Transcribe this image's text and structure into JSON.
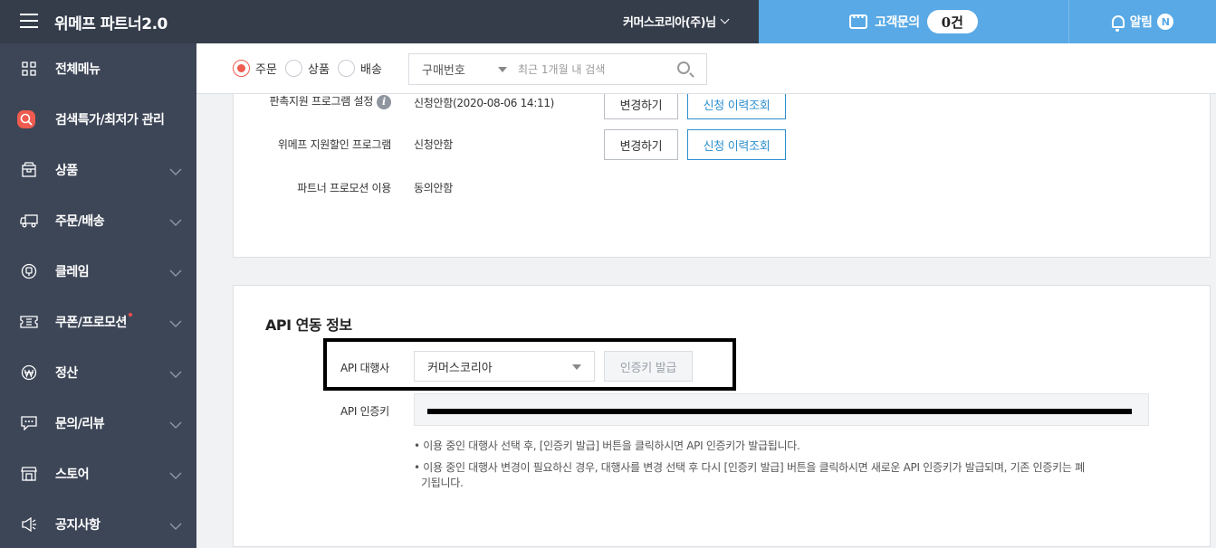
{
  "header": {
    "brand": "위메프 파트너2.0",
    "account": "커머스코리아(주)님",
    "cs_label": "고객문의",
    "cs_count": "0건",
    "alarm_label": "알림",
    "alarm_badge": "N"
  },
  "sidebar": {
    "items": [
      {
        "label": "전체메뉴",
        "icon": "grid-icon"
      },
      {
        "label": "검색특가/최저가 관리",
        "icon": "search-icon"
      },
      {
        "label": "상품",
        "icon": "box-icon"
      },
      {
        "label": "주문/배송",
        "icon": "truck-icon"
      },
      {
        "label": "클레임",
        "icon": "claim-icon"
      },
      {
        "label": "쿠폰/프로모션",
        "icon": "ticket-icon"
      },
      {
        "label": "정산",
        "icon": "won-icon"
      },
      {
        "label": "문의/리뷰",
        "icon": "chat-icon"
      },
      {
        "label": "스토어",
        "icon": "store-icon"
      },
      {
        "label": "공지사항",
        "icon": "megaphone-icon"
      }
    ]
  },
  "filterbar": {
    "radios": [
      "주문",
      "상품",
      "배송"
    ],
    "selected": "주문",
    "search_type": "구매번호",
    "search_placeholder": "최근 1개월 내 검색"
  },
  "promo": {
    "rows": [
      {
        "label": "판촉지원 프로그램 설정",
        "value": "신청안함(2020-08-06 14:11)"
      },
      {
        "label": "위메프 지원할인 프로그램",
        "value": "신청안함"
      },
      {
        "label": "파트너 프로모션 이용",
        "value": "동의안함"
      }
    ],
    "change_label": "변경하기",
    "history_label": "신청 이력조회"
  },
  "api": {
    "title": "API 연동 정보",
    "agency_label": "API 대행사",
    "agency_value": "커머스코리아",
    "issue_button": "인증키 발급",
    "key_label": "API 인증키",
    "notes": [
      "• 이용 중인 대행사 선택 후, [인증키 발급] 버튼을 클릭하시면 API 인증키가 발급됩니다.",
      "• 이용 중인 대행사 변경이 필요하신 경우, 대행사를 변경 선택 후 다시 [인증키 발급] 버튼을 클릭하시면 새로운 API 인증키가 발급되며, 기존 인증키는 폐",
      "기됩니다."
    ]
  },
  "colors": {
    "topbar": "#353d4b",
    "sidebar": "#3d4657",
    "accent_blue": "#58a9e5",
    "accent_red": "#ef5b4f",
    "link_blue": "#2c8fce"
  }
}
